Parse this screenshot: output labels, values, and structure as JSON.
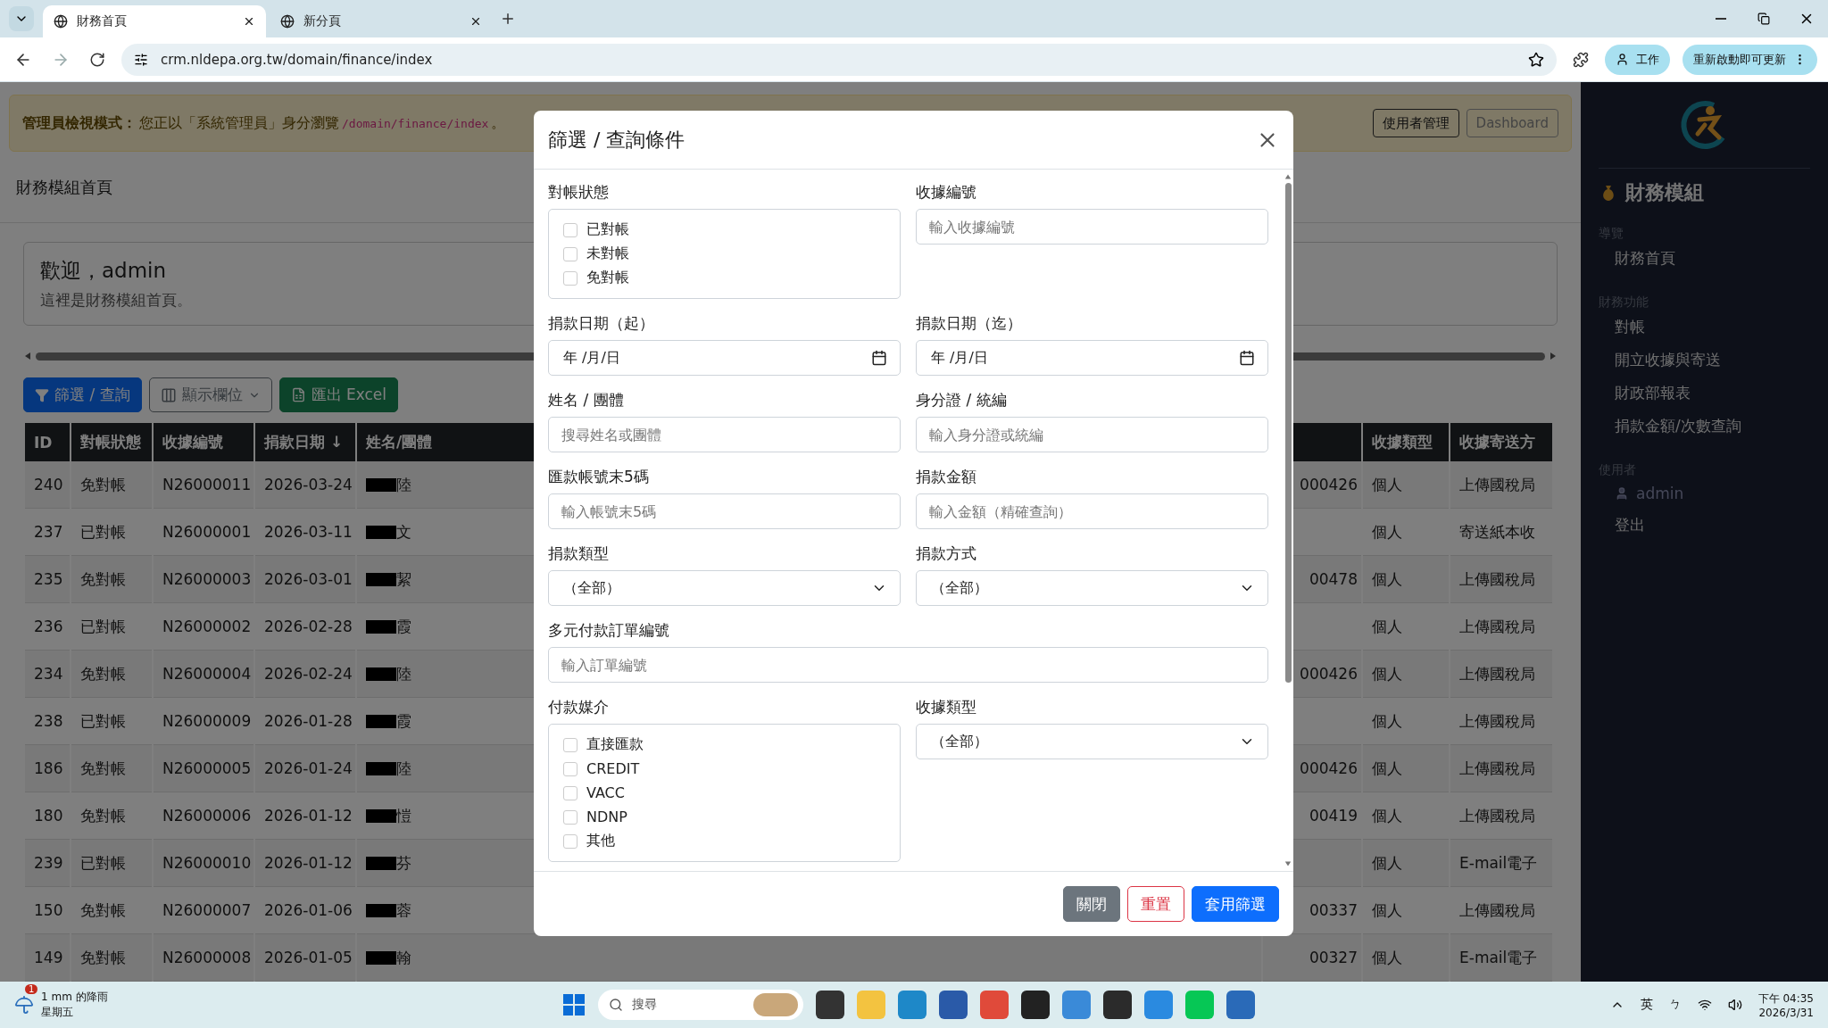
{
  "browser": {
    "tabs": [
      {
        "title": "財務首頁",
        "selected": true
      },
      {
        "title": "新分頁",
        "selected": false
      }
    ],
    "url": "crm.nldepa.org.tw/domain/finance/index",
    "profile": "工作",
    "update_button": "重新啟動即可更新"
  },
  "banner": {
    "label": "管理員檢視模式：",
    "text": "您正以「系統管理員」身分瀏覽",
    "path": "/domain/finance/index",
    "tail": "。",
    "buttons": [
      {
        "label": "使用者管理",
        "disabled": false
      },
      {
        "label": "Dashboard",
        "disabled": true
      }
    ]
  },
  "page_title": "財務模組首頁",
  "welcome": {
    "title": "歡迎，admin",
    "subtitle": "這裡是財務模組首頁。"
  },
  "toolbar": [
    {
      "label": "篩選 / 查詢",
      "kind": "primary"
    },
    {
      "label": "顯示欄位",
      "kind": "dropdown"
    },
    {
      "label": "匯出 Excel",
      "kind": "excel"
    }
  ],
  "table": {
    "columns": [
      "ID",
      "對帳狀態",
      "收據編號",
      "捐款日期 ↓",
      "姓名/團體",
      "收據類型",
      "收據寄送方"
    ],
    "rows": [
      {
        "id": "240",
        "status": "免對帳",
        "receipt_no": "N26000011",
        "date": "2026-03-24",
        "name": "陸",
        "column_6": "000426",
        "receipt_type": "個人",
        "delivery": "上傳國稅局"
      },
      {
        "id": "237",
        "status": "已對帳",
        "receipt_no": "N26000001",
        "date": "2026-03-11",
        "name": "文",
        "receipt_type": "個人",
        "delivery": "寄送紙本收"
      },
      {
        "id": "235",
        "status": "免對帳",
        "receipt_no": "N26000003",
        "date": "2026-03-01",
        "name": "絜",
        "column_6": "00478",
        "receipt_type": "個人",
        "delivery": "上傳國稅局"
      },
      {
        "id": "236",
        "status": "已對帳",
        "receipt_no": "N26000002",
        "date": "2026-02-28",
        "name": "霞",
        "receipt_type": "個人",
        "delivery": "上傳國稅局"
      },
      {
        "id": "234",
        "status": "免對帳",
        "receipt_no": "N26000004",
        "date": "2026-02-24",
        "name": "陸",
        "column_6": "000426",
        "receipt_type": "個人",
        "delivery": "上傳國稅局"
      },
      {
        "id": "238",
        "status": "已對帳",
        "receipt_no": "N26000009",
        "date": "2026-01-28",
        "name": "霞",
        "receipt_type": "個人",
        "delivery": "上傳國稅局"
      },
      {
        "id": "186",
        "status": "免對帳",
        "receipt_no": "N26000005",
        "date": "2026-01-24",
        "name": "陸",
        "column_6": "000426",
        "receipt_type": "個人",
        "delivery": "上傳國稅局"
      },
      {
        "id": "180",
        "status": "免對帳",
        "receipt_no": "N26000006",
        "date": "2026-01-12",
        "name": "愷",
        "column_6": "00419",
        "receipt_type": "個人",
        "delivery": "上傳國稅局"
      },
      {
        "id": "239",
        "status": "已對帳",
        "receipt_no": "N26000010",
        "date": "2026-01-12",
        "name": "芬",
        "receipt_type": "個人",
        "delivery": "E-mail電子"
      },
      {
        "id": "150",
        "status": "免對帳",
        "receipt_no": "N26000007",
        "date": "2026-01-06",
        "name": "蓉",
        "column_6": "00337",
        "receipt_type": "個人",
        "delivery": "上傳國稅局"
      },
      {
        "id": "149",
        "status": "免對帳",
        "receipt_no": "N26000008",
        "date": "2026-01-05",
        "name": "翰",
        "column_6": "00327",
        "receipt_type": "個人",
        "delivery": "E-mail電子"
      }
    ]
  },
  "sidebar": {
    "title": "財務模組",
    "sections": [
      {
        "heading": "導覽",
        "items": [
          {
            "label": "財務首頁",
            "kind": "link"
          }
        ]
      },
      {
        "heading": "財務功能",
        "items": [
          {
            "label": "對帳",
            "kind": "link"
          },
          {
            "label": "開立收據與寄送",
            "kind": "link"
          },
          {
            "label": "財政部報表",
            "kind": "link"
          },
          {
            "label": "捐款金額/次數查詢",
            "kind": "link"
          }
        ]
      },
      {
        "heading": "使用者",
        "items": [
          {
            "label": "admin",
            "kind": "user"
          },
          {
            "label": "登出",
            "kind": "link"
          }
        ]
      }
    ]
  },
  "modal": {
    "title": "篩選 / 查詢條件",
    "fields": [
      {
        "kind": "checkbox_group",
        "label": "對帳狀態",
        "options": [
          {
            "label": "已對帳",
            "checked": false
          },
          {
            "label": "未對帳",
            "checked": false
          },
          {
            "label": "免對帳",
            "checked": false
          }
        ]
      },
      {
        "kind": "text",
        "label": "收據編號",
        "placeholder": "輸入收據編號"
      },
      {
        "kind": "date",
        "label": "捐款日期（起）",
        "value": "年 /月/日"
      },
      {
        "kind": "date",
        "label": "捐款日期（迄）",
        "value": "年 /月/日"
      },
      {
        "kind": "text",
        "label": "姓名 / 團體",
        "placeholder": "搜尋姓名或團體"
      },
      {
        "kind": "text",
        "label": "身分證 / 統編",
        "placeholder": "輸入身分證或統編"
      },
      {
        "kind": "text",
        "label": "匯款帳號末5碼",
        "placeholder": "輸入帳號末5碼"
      },
      {
        "kind": "text",
        "label": "捐款金額",
        "placeholder": "輸入金額（精確查詢）"
      },
      {
        "kind": "select",
        "label": "捐款類型",
        "value": "（全部）"
      },
      {
        "kind": "select",
        "label": "捐款方式",
        "value": "（全部）"
      },
      {
        "kind": "wide_text",
        "label": "多元付款訂單編號",
        "placeholder": "輸入訂單編號"
      },
      {
        "kind": "checkbox_group",
        "label": "付款媒介",
        "options": [
          {
            "label": "直接匯款",
            "checked": false
          },
          {
            "label": "CREDIT",
            "checked": false
          },
          {
            "label": "VACC",
            "checked": false
          },
          {
            "label": "NDNP",
            "checked": false
          },
          {
            "label": "其他",
            "checked": false
          }
        ]
      },
      {
        "kind": "select",
        "label": "收據類型",
        "value": "（全部）"
      }
    ],
    "buttons": [
      {
        "label": "關閉",
        "kind": "secondary"
      },
      {
        "label": "重置",
        "kind": "outline_danger"
      },
      {
        "label": "套用篩選",
        "kind": "primary"
      }
    ]
  },
  "taskbar": {
    "weather": "1 mm 的降雨",
    "weather_day": "星期五",
    "weather_badge": "1",
    "search_placeholder": "搜尋",
    "ime_lang": "英",
    "ime_mode": "ㄅ",
    "time": "下午 04:35",
    "date": "2026/3/31"
  }
}
